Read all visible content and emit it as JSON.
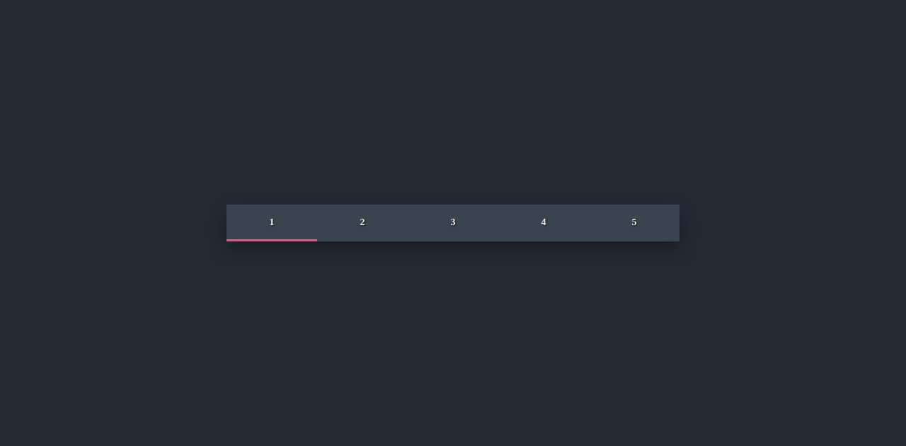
{
  "tabs": {
    "items": [
      {
        "label": "1",
        "active": true
      },
      {
        "label": "2",
        "active": false
      },
      {
        "label": "3",
        "active": false
      },
      {
        "label": "4",
        "active": false
      },
      {
        "label": "5",
        "active": false
      }
    ]
  },
  "colors": {
    "background": "#252b33",
    "tab_bar": "#3a444f",
    "text": "#f5f0e8",
    "accent": "#db5b90"
  }
}
